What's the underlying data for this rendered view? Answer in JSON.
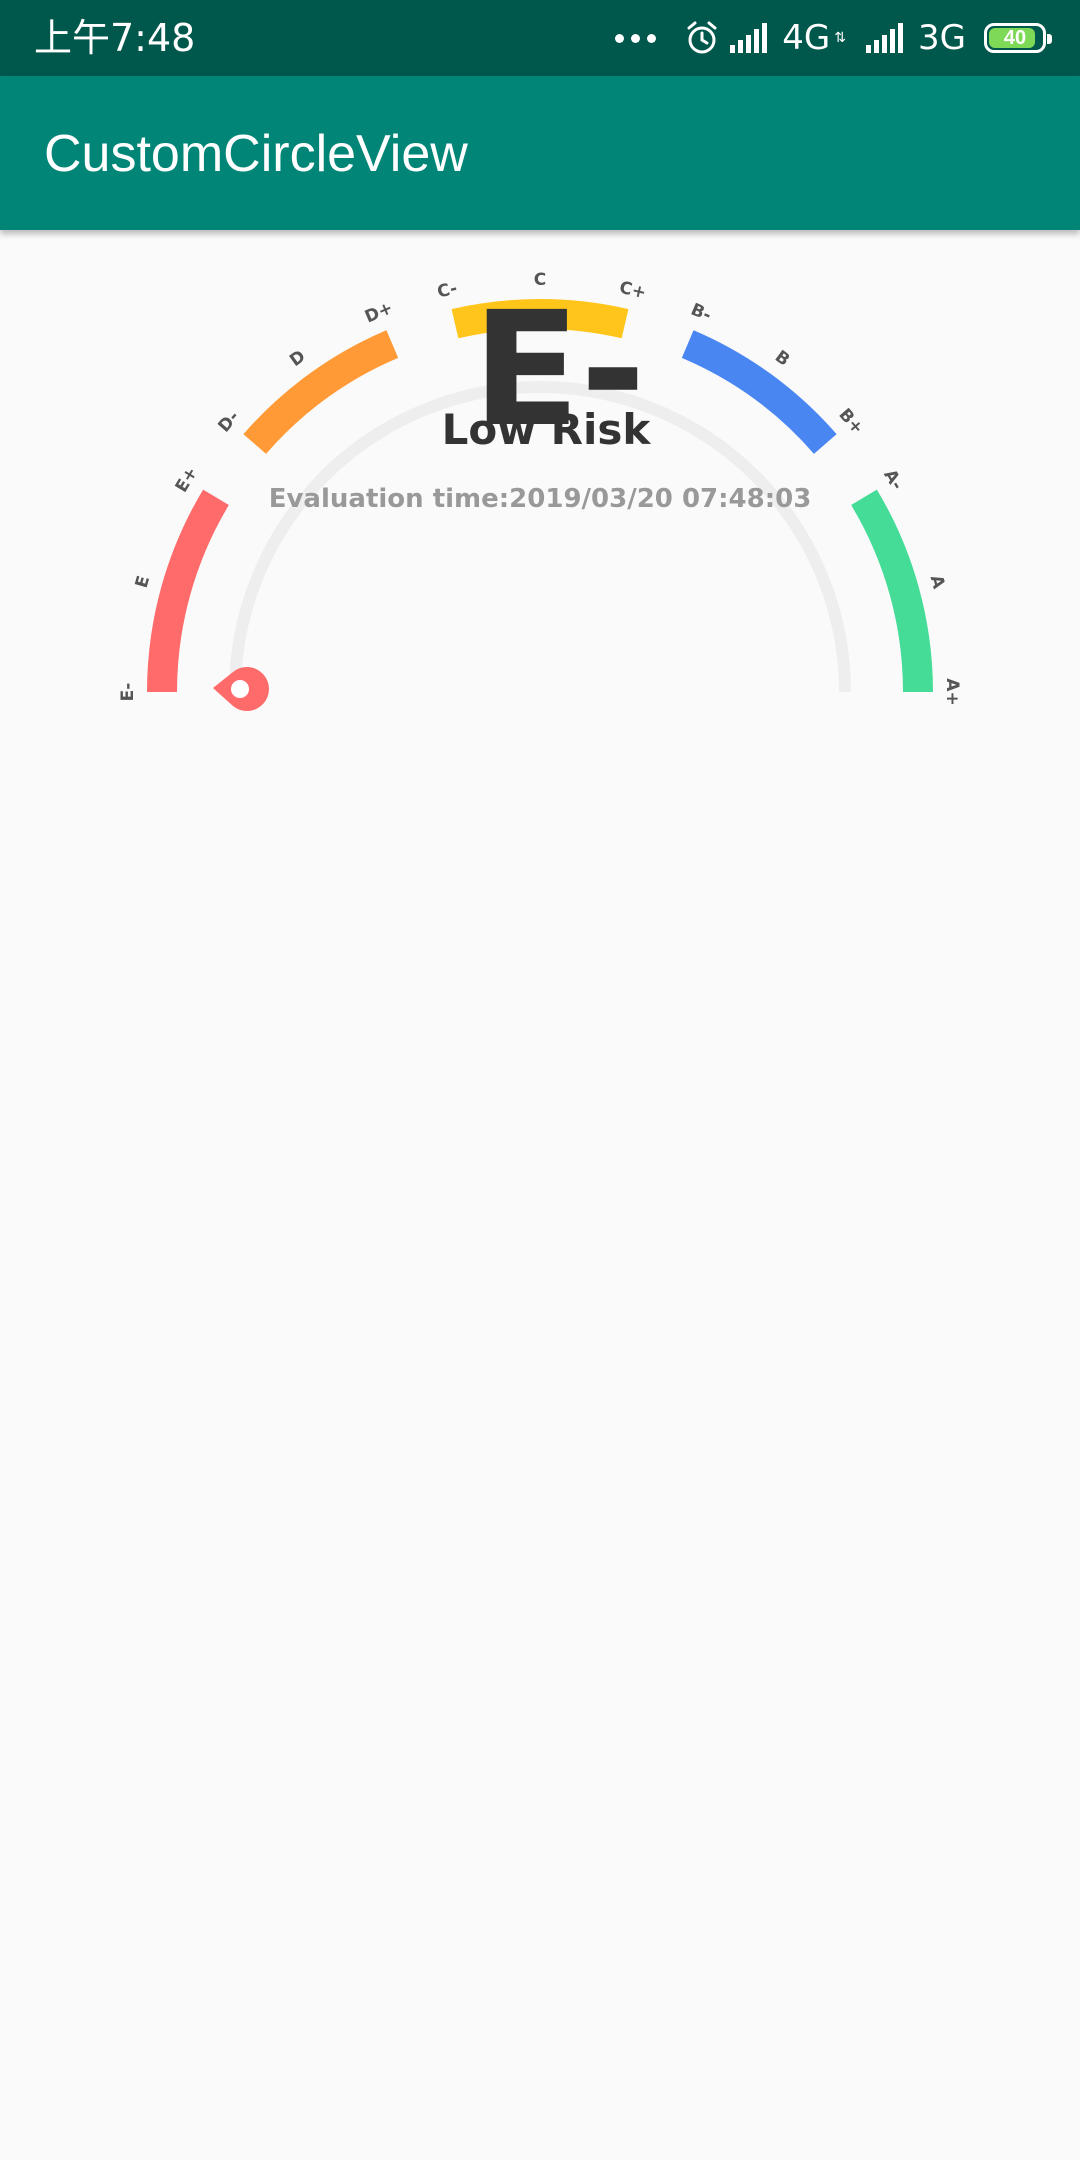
{
  "status_bar": {
    "time": "上午7:48",
    "network_1": "4G",
    "network_2": "3G",
    "battery_level": "40",
    "icons": [
      "more-dots-icon",
      "alarm-icon",
      "signal-icon",
      "signal-icon",
      "battery-icon"
    ]
  },
  "app_bar": {
    "title": "CustomCircleView"
  },
  "gauge": {
    "grade": "E-",
    "risk": "Low Risk",
    "evaluation": "Evaluation time:2019/03/20 07:48:03",
    "track_color": "#eeeeee",
    "pointer_color": "#ff6b6b",
    "segments": [
      {
        "color": "#ff6b6b",
        "labels": [
          "E-",
          "E",
          "E+"
        ]
      },
      {
        "color": "#ff9a36",
        "labels": [
          "D-",
          "D",
          "D+"
        ]
      },
      {
        "color": "#ffc51a",
        "labels": [
          "C-",
          "C",
          "C+"
        ]
      },
      {
        "color": "#4a86f2",
        "labels": [
          "B-",
          "B",
          "B+"
        ]
      },
      {
        "color": "#45dc98",
        "labels": [
          "A-",
          "A",
          "A+"
        ]
      }
    ]
  },
  "colors": {
    "status_bar": "#00574b",
    "app_bar": "#008577",
    "background": "#fafafa"
  }
}
